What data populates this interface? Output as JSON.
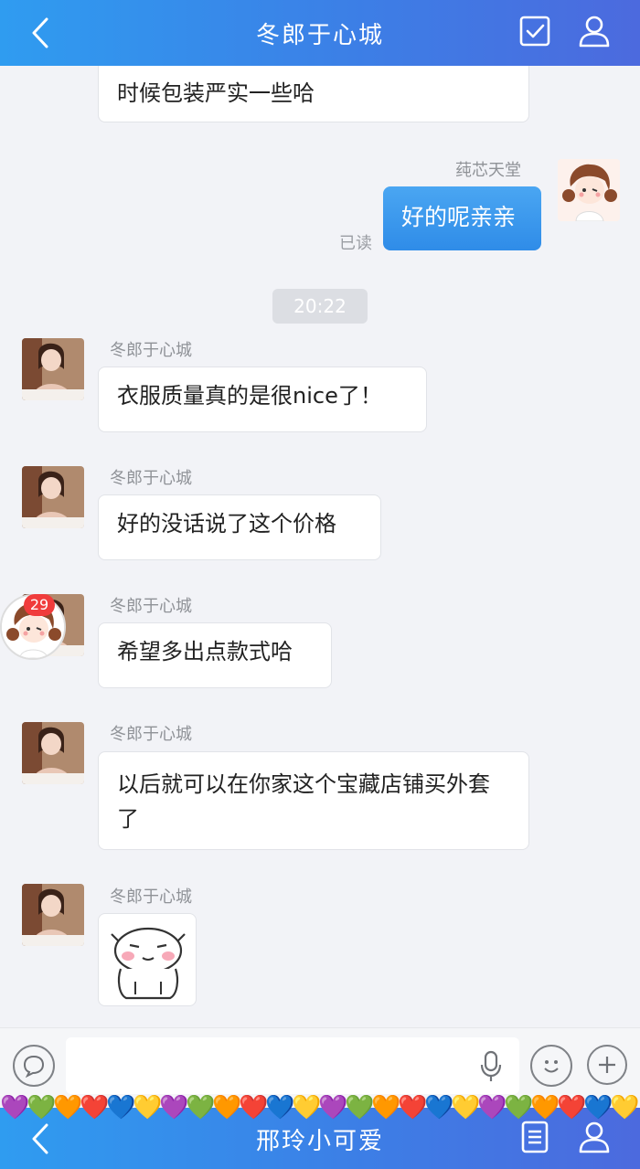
{
  "header": {
    "title": "冬郎于心城"
  },
  "messages": {
    "prev_text": "时候包装严实一些哈",
    "me_name": "莼芯天堂",
    "me_text": "好的呢亲亲",
    "read_label": "已读",
    "time": "20:22",
    "sender_name": "冬郎于心城",
    "m1": "衣服质量真的是很nice了！",
    "m2": "好的没话说了这个价格",
    "m3": "希望多出点款式哈",
    "m4": "以后就可以在你家这个宝藏店铺买外套了",
    "unread_badge": "29"
  },
  "footer": {
    "title": "邢玲小可爱"
  },
  "colors": {
    "header_blue": "#3c7fe6",
    "bubble_blue": "#2f8ce8",
    "badge_red": "#f03c3c"
  },
  "hearts": [
    "💜",
    "💚",
    "🧡",
    "❤️",
    "💙",
    "💛",
    "💜",
    "💚",
    "🧡",
    "❤️",
    "💙",
    "💛",
    "💜",
    "💚",
    "🧡",
    "❤️",
    "💙",
    "💛",
    "💜",
    "💚",
    "🧡",
    "❤️",
    "💙",
    "💛"
  ]
}
